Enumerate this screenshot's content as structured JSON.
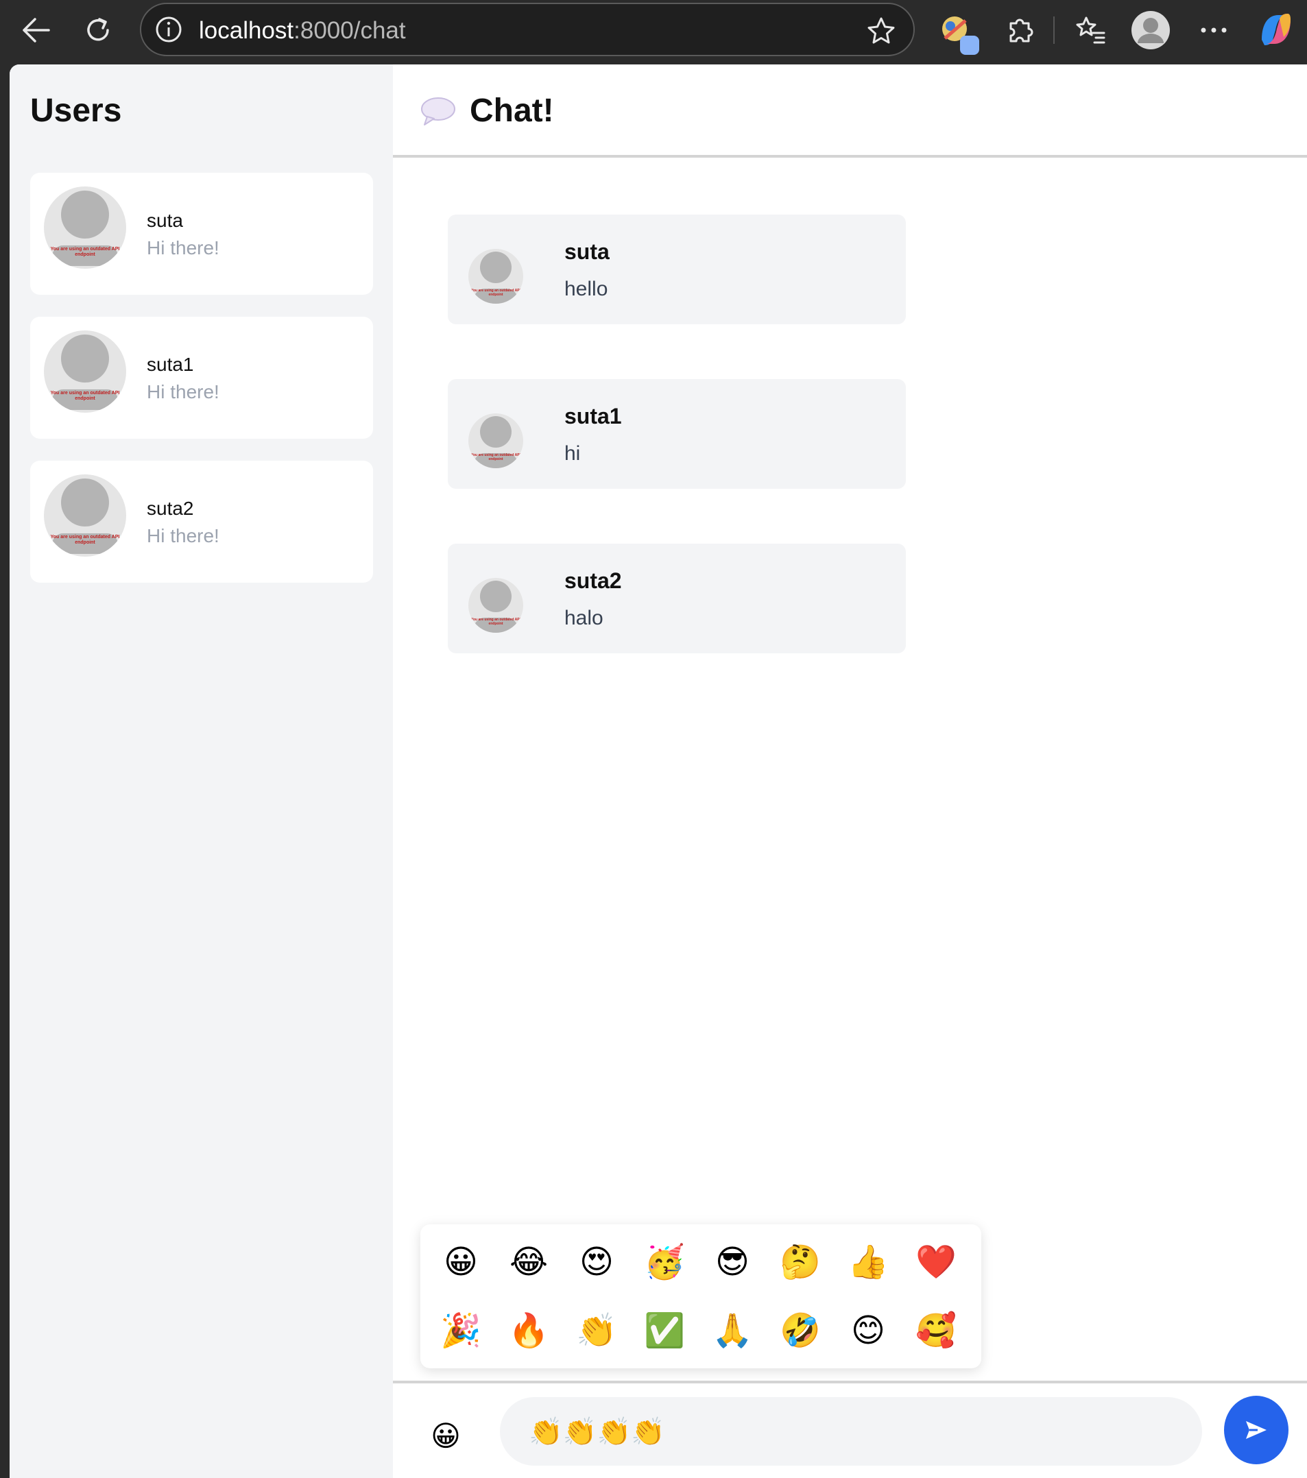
{
  "browser": {
    "url_host": "localhost",
    "url_path": ":8000/chat"
  },
  "sidebar": {
    "title": "Users",
    "users": [
      {
        "name": "suta",
        "preview": "Hi there!"
      },
      {
        "name": "suta1",
        "preview": "Hi there!"
      },
      {
        "name": "suta2",
        "preview": "Hi there!"
      }
    ],
    "avatar_note": "You are using an outdated API endpoint"
  },
  "chat": {
    "title": "Chat!",
    "messages": [
      {
        "author": "suta",
        "text": "hello"
      },
      {
        "author": "suta1",
        "text": "hi"
      },
      {
        "author": "suta2",
        "text": "halo"
      }
    ]
  },
  "emoji_picker": {
    "emojis": [
      "😀",
      "😂",
      "😍",
      "🥳",
      "😎",
      "🤔",
      "👍",
      "❤️",
      "🎉",
      "🔥",
      "👏",
      "✅",
      "🙏",
      "🤣",
      "😊",
      "🥰"
    ]
  },
  "composer": {
    "emoji_button": "😀",
    "input_value": "👏👏👏👏"
  },
  "colors": {
    "send_button": "#2563eb",
    "sidebar_bg": "#f3f4f6",
    "message_bg": "#f3f4f6"
  }
}
